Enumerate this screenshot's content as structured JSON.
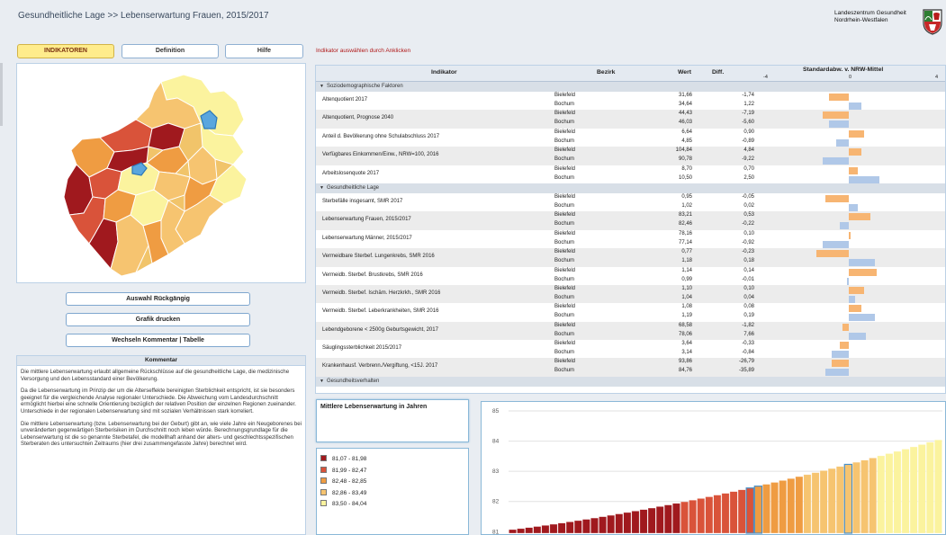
{
  "header": {
    "title": "Gesundheitliche Lage >> Lebenserwartung Frauen, 2015/2017",
    "org_line1": "Landeszentrum Gesundheit",
    "org_line2": "Nordrhein-Westfalen"
  },
  "tabs": {
    "indicators": "INDIKATOREN",
    "definition": "Definition",
    "help": "Hilfe"
  },
  "instruction": "Indikator auswählen durch Anklicken",
  "buttons": {
    "undo": "Auswahl Rückgängig",
    "print": "Grafik drucken",
    "toggle": "Wechseln Kommentar | Tabelle"
  },
  "comment": {
    "heading": "Kommentar",
    "p1": "Die mittlere Lebenserwartung erlaubt allgemeine Rückschlüsse auf die gesundheitliche Lage, die medizinische Versorgung und den Lebensstandard einer Bevölkerung.",
    "p2": "Da die Lebenserwartung im Prinzip der um die Alterseffekte bereinigten Sterblichkeit entspricht, ist sie besonders geeignet für die vergleichende Analyse regionaler Unterschiede. Die Abweichung vom Landesdurchschnitt ermöglicht hierbei eine schnelle Orientierung bezüglich der relativen Position der einzelnen Regionen zueinander. Unterschiede in der regionalen Lebenserwartung sind mit sozialen Verhältnissen stark korreliert.",
    "p3": "Die mittlere Lebenserwartung (bzw. Lebenserwartung bei der Geburt) gibt an, wie viele Jahre ein Neugeborenes bei unveränderten gegenwärtigen Sterberisiken im Durchschnitt noch leben würde. Berechnungsgrundlage für die Lebenserwartung ist die so genannte Sterbetafel, die modellhaft anhand der alters- und geschlechtsspezifischen Sterberaten des untersuchten Zeitraums (hier drei zusammengefasste Jahre) berechnet wird."
  },
  "table": {
    "headers": {
      "indicator": "Indikator",
      "district": "Bezirk",
      "value": "Wert",
      "diff": "Diff.",
      "std": "Standardabw. v. NRW-Mittel"
    },
    "scale": [
      "-4",
      "0",
      "4"
    ],
    "groups": [
      {
        "label": "Soziodemographische Faktoren",
        "rows": [
          {
            "name": "Altenquotient 2017",
            "a": [
              "Bielefeld",
              "31,66",
              "-1,74"
            ],
            "b": [
              "Bochum",
              "34,64",
              "1,22"
            ],
            "za": -0.9,
            "zb": 0.6
          },
          {
            "name": "Altenquotient, Prognose 2040",
            "a": [
              "Bielefeld",
              "44,43",
              "-7,19"
            ],
            "b": [
              "Bochum",
              "46,03",
              "-5,60"
            ],
            "za": -1.2,
            "zb": -0.9
          },
          {
            "name": "Anteil d. Bevölkerung ohne Schulabschluss 2017",
            "a": [
              "Bielefeld",
              "6,64",
              "0,90"
            ],
            "b": [
              "Bochum",
              "4,85",
              "-0,89"
            ],
            "za": 0.7,
            "zb": -0.6
          },
          {
            "name": "Verfügbares Einkommen/Einw., NRW=100, 2016",
            "a": [
              "Bielefeld",
              "104,84",
              "4,84"
            ],
            "b": [
              "Bochum",
              "90,78",
              "-9,22"
            ],
            "za": 0.6,
            "zb": -1.2
          },
          {
            "name": "Arbeitslosenquote 2017",
            "a": [
              "Bielefeld",
              "8,70",
              "0,70"
            ],
            "b": [
              "Bochum",
              "10,50",
              "2,50"
            ],
            "za": 0.4,
            "zb": 1.4
          }
        ]
      },
      {
        "label": "Gesundheitliche Lage",
        "rows": [
          {
            "name": "Sterbefälle insgesamt, SMR 2017",
            "a": [
              "Bielefeld",
              "0,95",
              "-0,05"
            ],
            "b": [
              "Bochum",
              "1,02",
              "0,02"
            ],
            "za": -1.1,
            "zb": 0.4
          },
          {
            "name": "Lebenserwartung Frauen, 2015/2017",
            "a": [
              "Bielefeld",
              "83,21",
              "0,53"
            ],
            "b": [
              "Bochum",
              "82,46",
              "-0,22"
            ],
            "za": 1.0,
            "zb": -0.4
          },
          {
            "name": "Lebenserwartung Männer, 2015/2017",
            "a": [
              "Bielefeld",
              "78,16",
              "0,10"
            ],
            "b": [
              "Bochum",
              "77,14",
              "-0,92"
            ],
            "za": 0.1,
            "zb": -1.2
          },
          {
            "name": "Vermeidbare Sterbef. Lungenkrebs, SMR 2016",
            "a": [
              "Bielefeld",
              "0,77",
              "-0,23"
            ],
            "b": [
              "Bochum",
              "1,18",
              "0,18"
            ],
            "za": -1.5,
            "zb": 1.2
          },
          {
            "name": "Vermeidb. Sterbef. Brustkrebs, SMR 2016",
            "a": [
              "Bielefeld",
              "1,14",
              "0,14"
            ],
            "b": [
              "Bochum",
              "0,99",
              "-0,01"
            ],
            "za": 1.3,
            "zb": -0.1
          },
          {
            "name": "Vermeidb. Sterbef. Ischäm. Herzkrkh., SMR 2016",
            "a": [
              "Bielefeld",
              "1,10",
              "0,10"
            ],
            "b": [
              "Bochum",
              "1,04",
              "0,04"
            ],
            "za": 0.7,
            "zb": 0.3
          },
          {
            "name": "Vermeidb. Sterbef. Leberkrankheiten, SMR 2016",
            "a": [
              "Bielefeld",
              "1,08",
              "0,08"
            ],
            "b": [
              "Bochum",
              "1,19",
              "0,19"
            ],
            "za": 0.6,
            "zb": 1.2
          },
          {
            "name": "Lebendgeborene < 2500g Geburtsgewicht, 2017",
            "a": [
              "Bielefeld",
              "68,58",
              "-1,82"
            ],
            "b": [
              "Bochum",
              "78,06",
              "7,66"
            ],
            "za": -0.3,
            "zb": 0.8
          },
          {
            "name": "Säuglingssterblichkeit 2015/2017",
            "a": [
              "Bielefeld",
              "3,64",
              "-0,33"
            ],
            "b": [
              "Bochum",
              "3,14",
              "-0,84"
            ],
            "za": -0.4,
            "zb": -0.8
          },
          {
            "name": "Krankenhausf. Verbrenn./Vergiftung, <15J. 2017",
            "a": [
              "Bielefeld",
              "93,86",
              "-26,79"
            ],
            "b": [
              "Bochum",
              "84,76",
              "-35,89"
            ],
            "za": -0.8,
            "zb": -1.1
          }
        ]
      },
      {
        "label": "Gesundheitsverhalten",
        "rows": []
      }
    ]
  },
  "chart": {
    "title": "Mittlere Lebenserwartung in Jahren",
    "legend": [
      {
        "label": "81,07 - 81,98",
        "color": "#a0191e"
      },
      {
        "label": "81,99 - 82,47",
        "color": "#d9533a"
      },
      {
        "label": "82,48 - 82,85",
        "color": "#ef9c42"
      },
      {
        "label": "82,86 - 83,49",
        "color": "#f6c470"
      },
      {
        "label": "83,50 - 84,04",
        "color": "#fbf39e"
      }
    ],
    "colors": {
      "pos": "#f7b572",
      "neg": "#b0c8e8",
      "highlight": "#4a90c8"
    }
  },
  "chart_data": {
    "type": "bar",
    "ylim": [
      80.95,
      85
    ],
    "yticks": [
      85,
      84,
      83,
      82,
      81
    ],
    "breaks": [
      81.98,
      82.47,
      82.85,
      83.49
    ],
    "start": 81.07,
    "end": 84.04,
    "count": 53,
    "highlight_values": [
      82.46,
      83.21
    ]
  }
}
